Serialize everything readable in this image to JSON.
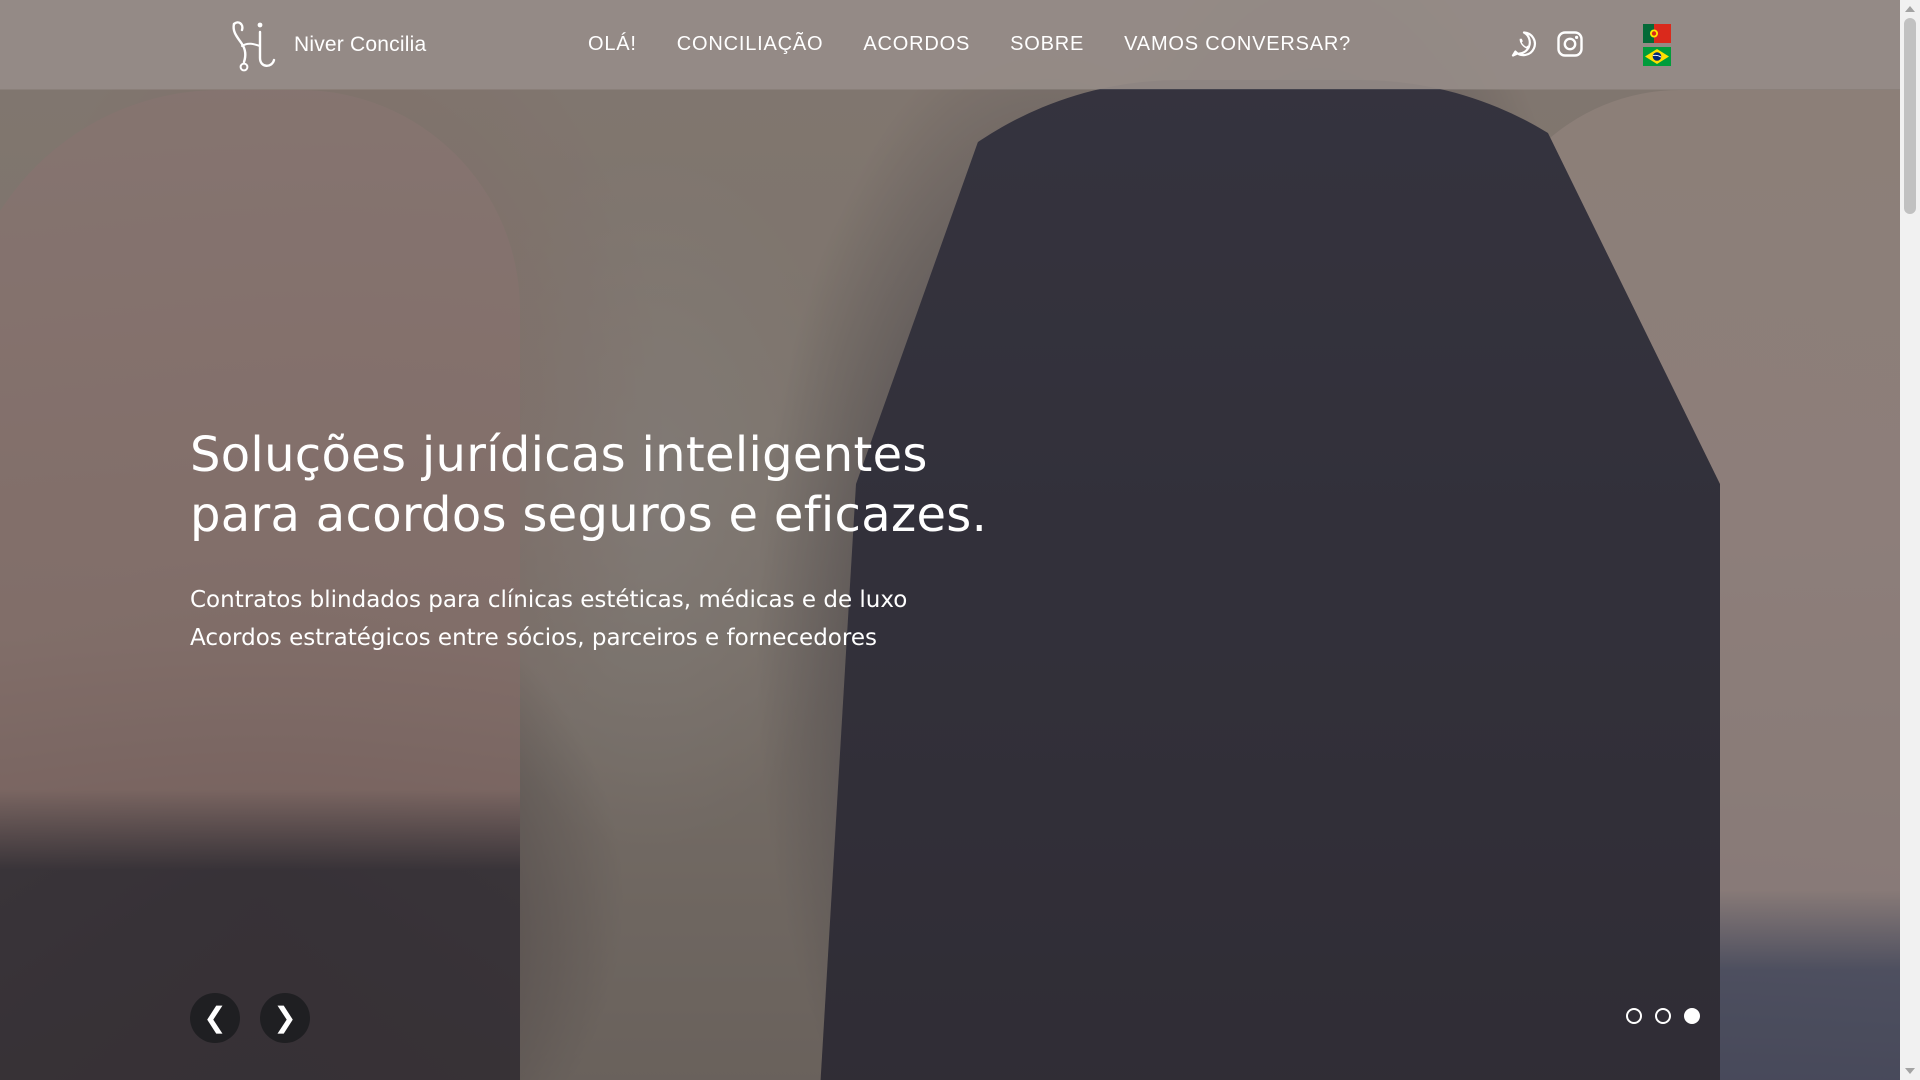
{
  "brand": {
    "name": "Niver Concilia",
    "logo_icon": "monogram-logo-icon"
  },
  "nav": {
    "items": [
      {
        "label": "OLÁ!"
      },
      {
        "label": "CONCILIAÇÃO"
      },
      {
        "label": "ACORDOS"
      },
      {
        "label": "SOBRE"
      },
      {
        "label": "VAMOS CONVERSAR?"
      }
    ]
  },
  "social": {
    "icons": [
      "whatsapp-icon",
      "instagram-icon"
    ]
  },
  "languages": {
    "options": [
      "flag-portugal-icon",
      "flag-brazil-icon"
    ]
  },
  "hero": {
    "title_lines": [
      "Soluções jurídicas inteligentes",
      "para acordos seguros e eficazes."
    ],
    "subtitle_lines": [
      "Contratos blindados para clínicas estéticas, médicas e de luxo",
      "Acordos estratégicos entre sócios, parceiros e fornecedores"
    ]
  },
  "carousel": {
    "prev_label": "❮",
    "next_label": "❯",
    "slide_count": 3,
    "active_slide": 3
  },
  "colors": {
    "header_bg": "#968c88",
    "text": "#ffffff",
    "arrow_bg": "#1f1f22"
  }
}
